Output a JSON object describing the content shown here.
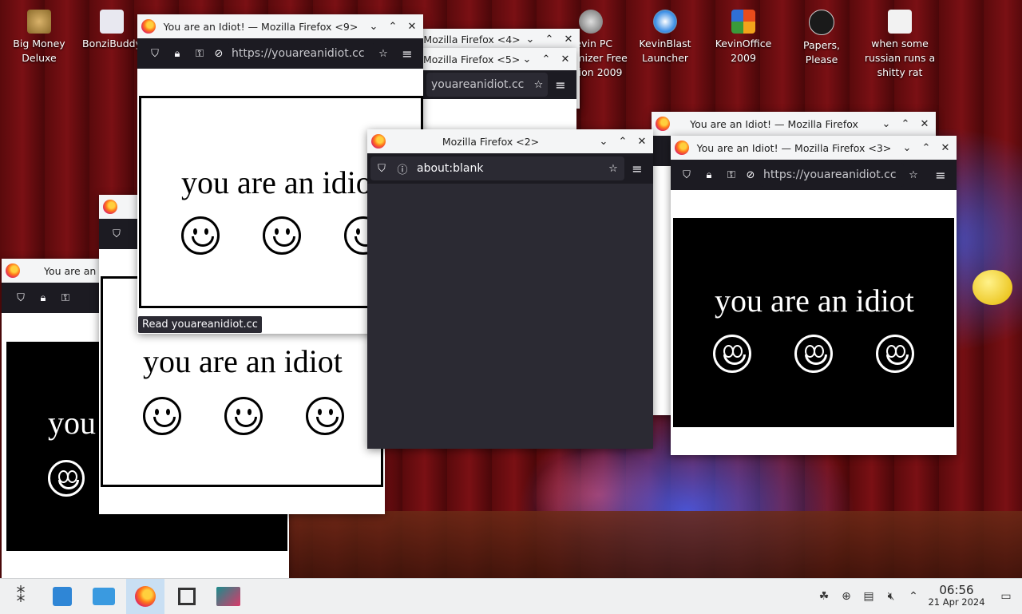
{
  "desktop": {
    "icons": [
      {
        "label": "Big Money Deluxe"
      },
      {
        "label": "BonziBuddy"
      },
      {
        "label": "KevinBlast Launcher"
      },
      {
        "label": "KevinOffice 2009"
      },
      {
        "label": "Papers, Please"
      },
      {
        "label": "when some russian runs a shitty rat"
      },
      {
        "label": "Kevin PC Optimizer Free Edition 2009"
      }
    ]
  },
  "windows": {
    "w9": {
      "title": "You are an Idiot! — Mozilla Firefox <9>",
      "url": "https://youareanidiot.cc",
      "page_text": "you are an idiot",
      "status_tooltip": "Read youareanidiot.cc"
    },
    "w4": {
      "title": "Mozilla Firefox <4>"
    },
    "w5": {
      "title": "Mozilla Firefox <5>",
      "url": "youareanidiot.cc"
    },
    "w2": {
      "title": "Mozilla Firefox <2>",
      "url": "about:blank"
    },
    "wback": {
      "title": "You are an Idiot! — Mozilla Firefox"
    },
    "w3": {
      "title": "You are an Idiot! — Mozilla Firefox <3>",
      "url": "https://youareanidiot.cc",
      "page_text": "you are an idiot"
    },
    "wleft": {
      "title": "You are an Idiot! — Mozilla Firefox",
      "page_text": "you are an idiot"
    },
    "wmid": {
      "page_text": "you are an idiot"
    }
  },
  "taskbar": {
    "clock_time": "06:56",
    "clock_date": "21 Apr 2024",
    "items": [
      "application-launcher",
      "discover",
      "file-manager",
      "firefox",
      "task-manager",
      "kde-connect"
    ]
  },
  "colors": {
    "toolbar": "#1c1b22",
    "urlbar": "#2b2a33",
    "titlebar": "#f4f5f6",
    "taskbar": "#eff0f1"
  }
}
